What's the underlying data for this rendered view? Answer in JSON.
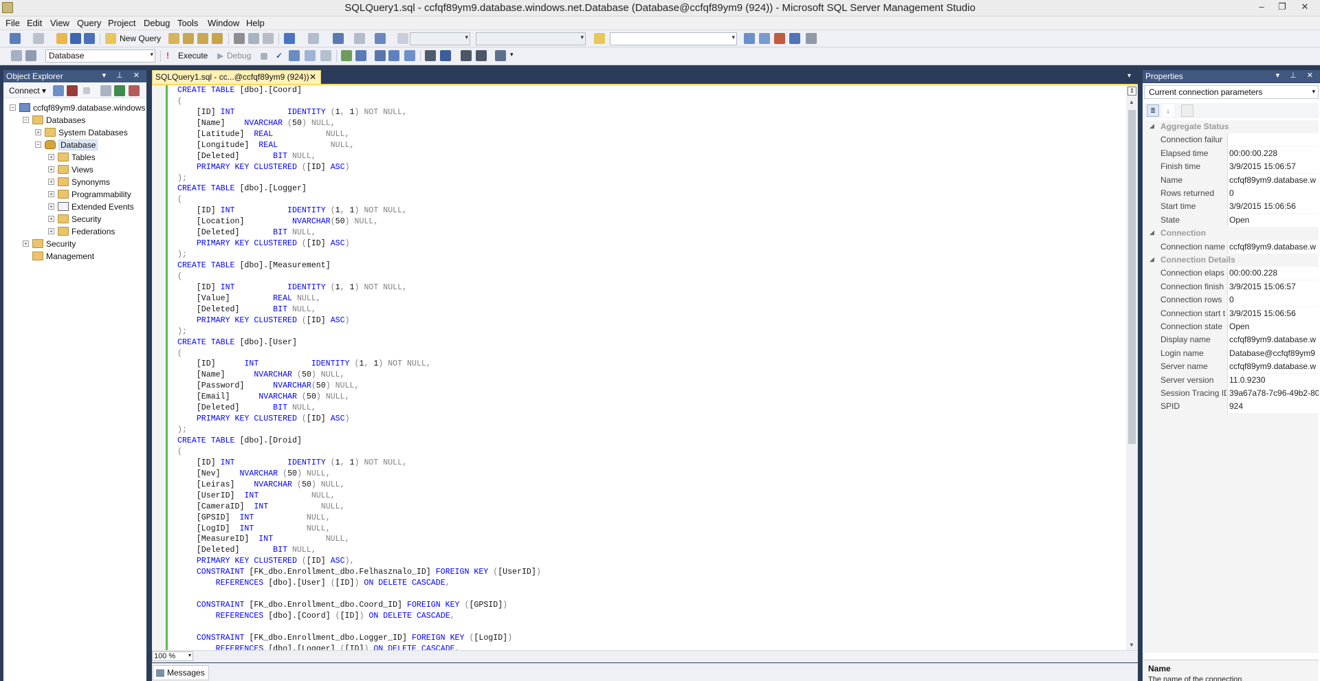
{
  "window": {
    "title": "SQLQuery1.sql - ccfqf89ym9.database.windows.net.Database (Database@ccfqf89ym9 (924)) - Microsoft SQL Server Management Studio",
    "minimize": "–",
    "restore": "❐",
    "close": "✕"
  },
  "menu": [
    "File",
    "Edit",
    "View",
    "Query",
    "Project",
    "Debug",
    "Tools",
    "Window",
    "Help"
  ],
  "toolbar": {
    "new_query": "New Query",
    "execute": "Execute",
    "debug": "Debug",
    "database_value": "Database"
  },
  "object_explorer": {
    "title": "Object Explorer",
    "connect": "Connect ▾",
    "tree": [
      {
        "label": "ccfqf89ym9.database.windows",
        "icon": "server-icon"
      },
      {
        "label": "Databases",
        "icon": "folder-icon"
      },
      {
        "label": "System Databases",
        "icon": "folder-icon"
      },
      {
        "label": "Database",
        "icon": "database-icon"
      },
      {
        "label": "Tables",
        "icon": "folder-icon"
      },
      {
        "label": "Views",
        "icon": "folder-icon"
      },
      {
        "label": "Synonyms",
        "icon": "folder-icon"
      },
      {
        "label": "Programmability",
        "icon": "folder-icon"
      },
      {
        "label": "Extended Events",
        "icon": "extended-events-icon"
      },
      {
        "label": "Security",
        "icon": "folder-icon"
      },
      {
        "label": "Federations",
        "icon": "folder-icon"
      },
      {
        "label": "Security",
        "icon": "folder-icon"
      },
      {
        "label": "Management",
        "icon": "folder-icon"
      }
    ]
  },
  "editor": {
    "tab_label": "SQLQuery1.sql - cc...@ccfqf89ym9 (924))",
    "tab_close": "✕",
    "zoom": "100 %",
    "results_tab": "Messages"
  },
  "properties": {
    "title": "Properties",
    "selector": "Current connection parameters",
    "rows": [
      {
        "type": "cat",
        "name": "Aggregate Status"
      },
      {
        "name": "Connection failur",
        "value": ""
      },
      {
        "name": "Elapsed time",
        "value": "00:00:00.228"
      },
      {
        "name": "Finish time",
        "value": "3/9/2015 15:06:57"
      },
      {
        "name": "Name",
        "value": "ccfqf89ym9.database.w"
      },
      {
        "name": "Rows returned",
        "value": "0"
      },
      {
        "name": "Start time",
        "value": "3/9/2015 15:06:56"
      },
      {
        "name": "State",
        "value": "Open"
      },
      {
        "type": "cat",
        "name": "Connection"
      },
      {
        "name": "Connection name",
        "value": "ccfqf89ym9.database.w"
      },
      {
        "type": "cat",
        "name": "Connection Details"
      },
      {
        "name": "Connection elaps",
        "value": "00:00:00.228"
      },
      {
        "name": "Connection finish",
        "value": "3/9/2015 15:06:57"
      },
      {
        "name": "Connection rows",
        "value": "0"
      },
      {
        "name": "Connection start t",
        "value": "3/9/2015 15:06:56"
      },
      {
        "name": "Connection state",
        "value": "Open"
      },
      {
        "name": "Display name",
        "value": "ccfqf89ym9.database.w"
      },
      {
        "name": "Login name",
        "value": "Database@ccfqf89ym9"
      },
      {
        "name": "Server name",
        "value": "ccfqf89ym9.database.w"
      },
      {
        "name": "Server version",
        "value": "11.0.9230"
      },
      {
        "name": "Session Tracing ID",
        "value": "39a67a78-7c96-49b2-80"
      },
      {
        "name": "SPID",
        "value": "924"
      }
    ],
    "desc_name": "Name",
    "desc_text": "The name of the connection."
  },
  "code_lines": [
    [
      [
        "t",
        "CREATE TABLE"
      ],
      [
        "n",
        " [dbo].[Coord]"
      ]
    ],
    [
      [
        "g",
        "("
      ]
    ],
    [
      [
        "n",
        "    [ID] "
      ],
      [
        "t",
        "INT"
      ],
      [
        "n",
        "           "
      ],
      [
        "t",
        "IDENTITY"
      ],
      [
        "n",
        " "
      ],
      [
        "g",
        "("
      ],
      [
        "n",
        "1"
      ],
      [
        "g",
        ","
      ],
      [
        "n",
        " 1"
      ],
      [
        "g",
        ")"
      ],
      [
        "n",
        " "
      ],
      [
        "g",
        "NOT NULL,"
      ]
    ],
    [
      [
        "n",
        "    [Name]    "
      ],
      [
        "t",
        "NVARCHAR"
      ],
      [
        "n",
        " "
      ],
      [
        "g",
        "("
      ],
      [
        "n",
        "50"
      ],
      [
        "g",
        ")"
      ],
      [
        "n",
        " "
      ],
      [
        "g",
        "NULL,"
      ]
    ],
    [
      [
        "n",
        "    [Latitude]  "
      ],
      [
        "t",
        "REAL"
      ],
      [
        "n",
        "           "
      ],
      [
        "g",
        "NULL,"
      ]
    ],
    [
      [
        "n",
        "    [Longitude]  "
      ],
      [
        "t",
        "REAL"
      ],
      [
        "n",
        "           "
      ],
      [
        "g",
        "NULL,"
      ]
    ],
    [
      [
        "n",
        "    [Deleted]       "
      ],
      [
        "t",
        "BIT"
      ],
      [
        "n",
        " "
      ],
      [
        "g",
        "NULL,"
      ]
    ],
    [
      [
        "n",
        "    "
      ],
      [
        "t",
        "PRIMARY KEY CLUSTERED"
      ],
      [
        "n",
        " "
      ],
      [
        "g",
        "("
      ],
      [
        "n",
        "[ID] "
      ],
      [
        "t",
        "ASC"
      ],
      [
        "g",
        ")"
      ]
    ],
    [
      [
        "g",
        ");"
      ]
    ],
    [
      [
        "t",
        "CREATE TABLE"
      ],
      [
        "n",
        " [dbo].[Logger]"
      ]
    ],
    [
      [
        "g",
        "("
      ]
    ],
    [
      [
        "n",
        "    [ID] "
      ],
      [
        "t",
        "INT"
      ],
      [
        "n",
        "           "
      ],
      [
        "t",
        "IDENTITY"
      ],
      [
        "n",
        " "
      ],
      [
        "g",
        "("
      ],
      [
        "n",
        "1"
      ],
      [
        "g",
        ","
      ],
      [
        "n",
        " 1"
      ],
      [
        "g",
        ")"
      ],
      [
        "n",
        " "
      ],
      [
        "g",
        "NOT NULL,"
      ]
    ],
    [
      [
        "n",
        "    [Location]          "
      ],
      [
        "t",
        "NVARCHAR"
      ],
      [
        "g",
        "("
      ],
      [
        "n",
        "50"
      ],
      [
        "g",
        ")"
      ],
      [
        "n",
        " "
      ],
      [
        "g",
        "NULL,"
      ]
    ],
    [
      [
        "n",
        "    [Deleted]       "
      ],
      [
        "t",
        "BIT"
      ],
      [
        "n",
        " "
      ],
      [
        "g",
        "NULL,"
      ]
    ],
    [
      [
        "n",
        "    "
      ],
      [
        "t",
        "PRIMARY KEY CLUSTERED"
      ],
      [
        "n",
        " "
      ],
      [
        "g",
        "("
      ],
      [
        "n",
        "[ID] "
      ],
      [
        "t",
        "ASC"
      ],
      [
        "g",
        ")"
      ]
    ],
    [
      [
        "g",
        ");"
      ]
    ],
    [
      [
        "t",
        "CREATE TABLE"
      ],
      [
        "n",
        " [dbo].[Measurement]"
      ]
    ],
    [
      [
        "g",
        "("
      ]
    ],
    [
      [
        "n",
        "    [ID] "
      ],
      [
        "t",
        "INT"
      ],
      [
        "n",
        "           "
      ],
      [
        "t",
        "IDENTITY"
      ],
      [
        "n",
        " "
      ],
      [
        "g",
        "("
      ],
      [
        "n",
        "1"
      ],
      [
        "g",
        ","
      ],
      [
        "n",
        " 1"
      ],
      [
        "g",
        ")"
      ],
      [
        "n",
        " "
      ],
      [
        "g",
        "NOT NULL,"
      ]
    ],
    [
      [
        "n",
        "    [Value]         "
      ],
      [
        "t",
        "REAL"
      ],
      [
        "n",
        " "
      ],
      [
        "g",
        "NULL,"
      ]
    ],
    [
      [
        "n",
        "    [Deleted]       "
      ],
      [
        "t",
        "BIT"
      ],
      [
        "n",
        " "
      ],
      [
        "g",
        "NULL,"
      ]
    ],
    [
      [
        "n",
        "    "
      ],
      [
        "t",
        "PRIMARY KEY CLUSTERED"
      ],
      [
        "n",
        " "
      ],
      [
        "g",
        "("
      ],
      [
        "n",
        "[ID] "
      ],
      [
        "t",
        "ASC"
      ],
      [
        "g",
        ")"
      ]
    ],
    [
      [
        "g",
        ");"
      ]
    ],
    [
      [
        "t",
        "CREATE TABLE"
      ],
      [
        "n",
        " [dbo].[User]"
      ]
    ],
    [
      [
        "g",
        "("
      ]
    ],
    [
      [
        "n",
        "    [ID]      "
      ],
      [
        "t",
        "INT"
      ],
      [
        "n",
        "           "
      ],
      [
        "t",
        "IDENTITY"
      ],
      [
        "n",
        " "
      ],
      [
        "g",
        "("
      ],
      [
        "n",
        "1"
      ],
      [
        "g",
        ","
      ],
      [
        "n",
        " 1"
      ],
      [
        "g",
        ")"
      ],
      [
        "n",
        " "
      ],
      [
        "g",
        "NOT NULL,"
      ]
    ],
    [
      [
        "n",
        "    [Name]      "
      ],
      [
        "t",
        "NVARCHAR"
      ],
      [
        "n",
        " "
      ],
      [
        "g",
        "("
      ],
      [
        "n",
        "50"
      ],
      [
        "g",
        ")"
      ],
      [
        "n",
        " "
      ],
      [
        "g",
        "NULL,"
      ]
    ],
    [
      [
        "n",
        "    [Password]      "
      ],
      [
        "t",
        "NVARCHAR"
      ],
      [
        "g",
        "("
      ],
      [
        "n",
        "50"
      ],
      [
        "g",
        ")"
      ],
      [
        "n",
        " "
      ],
      [
        "g",
        "NULL,"
      ]
    ],
    [
      [
        "n",
        "    [Email]      "
      ],
      [
        "t",
        "NVARCHAR"
      ],
      [
        "n",
        " "
      ],
      [
        "g",
        "("
      ],
      [
        "n",
        "50"
      ],
      [
        "g",
        ")"
      ],
      [
        "n",
        " "
      ],
      [
        "g",
        "NULL,"
      ]
    ],
    [
      [
        "n",
        "    [Deleted]       "
      ],
      [
        "t",
        "BIT"
      ],
      [
        "n",
        " "
      ],
      [
        "g",
        "NULL,"
      ]
    ],
    [
      [
        "n",
        "    "
      ],
      [
        "t",
        "PRIMARY KEY CLUSTERED"
      ],
      [
        "n",
        " "
      ],
      [
        "g",
        "("
      ],
      [
        "n",
        "[ID] "
      ],
      [
        "t",
        "ASC"
      ],
      [
        "g",
        ")"
      ]
    ],
    [
      [
        "g",
        ");"
      ]
    ],
    [
      [
        "t",
        "CREATE TABLE"
      ],
      [
        "n",
        " [dbo].[Droid]"
      ]
    ],
    [
      [
        "g",
        "("
      ]
    ],
    [
      [
        "n",
        "    [ID] "
      ],
      [
        "t",
        "INT"
      ],
      [
        "n",
        "           "
      ],
      [
        "t",
        "IDENTITY"
      ],
      [
        "n",
        " "
      ],
      [
        "g",
        "("
      ],
      [
        "n",
        "1"
      ],
      [
        "g",
        ","
      ],
      [
        "n",
        " 1"
      ],
      [
        "g",
        ")"
      ],
      [
        "n",
        " "
      ],
      [
        "g",
        "NOT NULL,"
      ]
    ],
    [
      [
        "n",
        "    [Nev]    "
      ],
      [
        "t",
        "NVARCHAR"
      ],
      [
        "n",
        " "
      ],
      [
        "g",
        "("
      ],
      [
        "n",
        "50"
      ],
      [
        "g",
        ")"
      ],
      [
        "n",
        " "
      ],
      [
        "g",
        "NULL,"
      ]
    ],
    [
      [
        "n",
        "    [Leiras]    "
      ],
      [
        "t",
        "NVARCHAR"
      ],
      [
        "n",
        " "
      ],
      [
        "g",
        "("
      ],
      [
        "n",
        "50"
      ],
      [
        "g",
        ")"
      ],
      [
        "n",
        " "
      ],
      [
        "g",
        "NULL,"
      ]
    ],
    [
      [
        "n",
        "    [UserID]  "
      ],
      [
        "t",
        "INT"
      ],
      [
        "n",
        "           "
      ],
      [
        "g",
        "NULL,"
      ]
    ],
    [
      [
        "n",
        "    [CameraID]  "
      ],
      [
        "t",
        "INT"
      ],
      [
        "n",
        "           "
      ],
      [
        "g",
        "NULL,"
      ]
    ],
    [
      [
        "n",
        "    [GPSID]  "
      ],
      [
        "t",
        "INT"
      ],
      [
        "n",
        "           "
      ],
      [
        "g",
        "NULL,"
      ]
    ],
    [
      [
        "n",
        "    [LogID]  "
      ],
      [
        "t",
        "INT"
      ],
      [
        "n",
        "           "
      ],
      [
        "g",
        "NULL,"
      ]
    ],
    [
      [
        "n",
        "    [MeasureID]  "
      ],
      [
        "t",
        "INT"
      ],
      [
        "n",
        "           "
      ],
      [
        "g",
        "NULL,"
      ]
    ],
    [
      [
        "n",
        "    [Deleted]       "
      ],
      [
        "t",
        "BIT"
      ],
      [
        "n",
        " "
      ],
      [
        "g",
        "NULL,"
      ]
    ],
    [
      [
        "n",
        "    "
      ],
      [
        "t",
        "PRIMARY KEY CLUSTERED"
      ],
      [
        "n",
        " "
      ],
      [
        "g",
        "("
      ],
      [
        "n",
        "[ID] "
      ],
      [
        "t",
        "ASC"
      ],
      [
        "g",
        "),"
      ]
    ],
    [
      [
        "n",
        "    "
      ],
      [
        "t",
        "CONSTRAINT"
      ],
      [
        "n",
        " [FK_dbo.Enrollment_dbo.Felhasznalo_ID] "
      ],
      [
        "t",
        "FOREIGN KEY"
      ],
      [
        "n",
        " "
      ],
      [
        "g",
        "("
      ],
      [
        "n",
        "[UserID]"
      ],
      [
        "g",
        ")"
      ]
    ],
    [
      [
        "n",
        "        "
      ],
      [
        "t",
        "REFERENCES"
      ],
      [
        "n",
        " [dbo].[User] "
      ],
      [
        "g",
        "("
      ],
      [
        "n",
        "[ID]"
      ],
      [
        "g",
        ")"
      ],
      [
        "n",
        " "
      ],
      [
        "t",
        "ON DELETE CASCADE"
      ],
      [
        "g",
        ","
      ]
    ],
    [
      [
        "n",
        ""
      ]
    ],
    [
      [
        "n",
        "    "
      ],
      [
        "t",
        "CONSTRAINT"
      ],
      [
        "n",
        " [FK_dbo.Enrollment_dbo.Coord_ID] "
      ],
      [
        "t",
        "FOREIGN KEY"
      ],
      [
        "n",
        " "
      ],
      [
        "g",
        "("
      ],
      [
        "n",
        "[GPSID]"
      ],
      [
        "g",
        ")"
      ]
    ],
    [
      [
        "n",
        "        "
      ],
      [
        "t",
        "REFERENCES"
      ],
      [
        "n",
        " [dbo].[Coord] "
      ],
      [
        "g",
        "("
      ],
      [
        "n",
        "[ID]"
      ],
      [
        "g",
        ")"
      ],
      [
        "n",
        " "
      ],
      [
        "t",
        "ON DELETE CASCADE"
      ],
      [
        "g",
        ","
      ]
    ],
    [
      [
        "n",
        ""
      ]
    ],
    [
      [
        "n",
        "    "
      ],
      [
        "t",
        "CONSTRAINT"
      ],
      [
        "n",
        " [FK_dbo.Enrollment_dbo.Logger_ID] "
      ],
      [
        "t",
        "FOREIGN KEY"
      ],
      [
        "n",
        " "
      ],
      [
        "g",
        "("
      ],
      [
        "n",
        "[LogID]"
      ],
      [
        "g",
        ")"
      ]
    ],
    [
      [
        "n",
        "        "
      ],
      [
        "t",
        "REFERENCES"
      ],
      [
        "n",
        " [dbo].[Logger] "
      ],
      [
        "g",
        "("
      ],
      [
        "n",
        "[ID]"
      ],
      [
        "g",
        ")"
      ],
      [
        "n",
        " "
      ],
      [
        "t",
        "ON DELETE CASCADE"
      ],
      [
        "g",
        ","
      ]
    ]
  ]
}
